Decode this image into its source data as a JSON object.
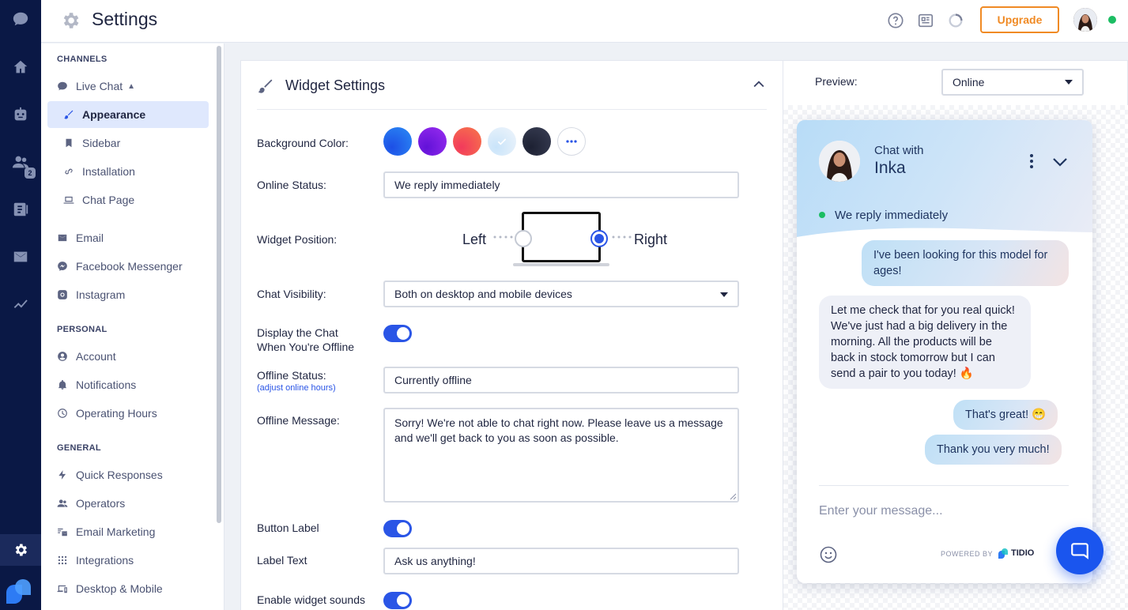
{
  "app": {
    "page_title": "Settings",
    "upgrade_label": "Upgrade",
    "rail_badge": "2"
  },
  "sidebar": {
    "channels_header": "CHANNELS",
    "personal_header": "PERSONAL",
    "general_header": "GENERAL",
    "live_chat": "Live Chat",
    "items": {
      "appearance": "Appearance",
      "sidebar": "Sidebar",
      "installation": "Installation",
      "chat_page": "Chat Page",
      "email": "Email",
      "facebook": "Facebook Messenger",
      "instagram": "Instagram",
      "account": "Account",
      "notifications": "Notifications",
      "operating_hours": "Operating Hours",
      "quick_responses": "Quick Responses",
      "operators": "Operators",
      "email_marketing": "Email Marketing",
      "integrations": "Integrations",
      "desktop_mobile": "Desktop & Mobile"
    }
  },
  "settings": {
    "panel_title": "Widget Settings",
    "background_color_label": "Background Color:",
    "colors": [
      "#1a6bf0",
      "#7a19e6",
      "#f34b54",
      "#dbeefc",
      "#262a3a"
    ],
    "online_status_label": "Online Status:",
    "online_status_value": "We reply immediately",
    "widget_position_label": "Widget Position:",
    "position_left": "Left",
    "position_right": "Right",
    "position_selected": "Right",
    "chat_visibility_label": "Chat Visibility:",
    "chat_visibility_value": "Both on desktop and mobile devices",
    "display_offline_label_1": "Display the Chat",
    "display_offline_label_2": "When You're Offline",
    "display_offline_enabled": true,
    "offline_status_label": "Offline Status:",
    "adjust_hours_link": "(adjust online hours)",
    "offline_status_value": "Currently offline",
    "offline_message_label": "Offline Message:",
    "offline_message_value": "Sorry! We're not able to chat right now. Please leave us a message and we'll get back to you as soon as possible.",
    "button_label_label": "Button Label",
    "button_label_enabled": true,
    "label_text_label": "Label Text",
    "label_text_value": "Ask us anything!",
    "widget_sounds_label": "Enable widget sounds",
    "widget_sounds_enabled": true
  },
  "preview": {
    "label": "Preview:",
    "mode": "Online",
    "chat_with": "Chat with",
    "agent_name": "Inka",
    "status_text": "We reply immediately",
    "messages": [
      {
        "from": "visitor",
        "text": "I've been looking for this model for ages!"
      },
      {
        "from": "agent",
        "text": "Let me check that for you real quick! We've just had a big delivery in the morning. All the products will be back in stock tomorrow but I can send a pair to you today! 🔥"
      },
      {
        "from": "visitor",
        "text": "That's great! 😁"
      },
      {
        "from": "visitor",
        "text": "Thank you very much!"
      }
    ],
    "input_placeholder": "Enter your message...",
    "powered_by": "POWERED BY",
    "brand": "TIDIO"
  }
}
